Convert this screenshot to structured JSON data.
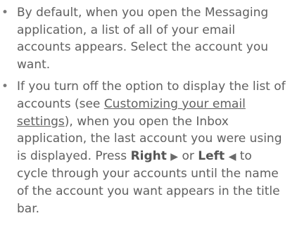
{
  "bullets": [
    {
      "text": "By default, when you open the Messaging application, a list of all of your email accounts appears. Select the account you want."
    },
    {
      "part1": "If you turn off the option to display the list of accounts (see ",
      "link": "Customizing your email settings",
      "part2": "), when you open the Inbox application, the last account you were using is displayed. Press ",
      "right_label": "Right",
      "right_arrow": "▶",
      "or_text": " or ",
      "left_label": "Left",
      "left_arrow": "◀",
      "part3": " to cycle through your accounts until the name of the account you want appears in the title bar."
    }
  ],
  "icons": {
    "bullet": "•",
    "right_arrow_icon": "right-triangle-arrow",
    "left_arrow_icon": "left-triangle-arrow"
  }
}
